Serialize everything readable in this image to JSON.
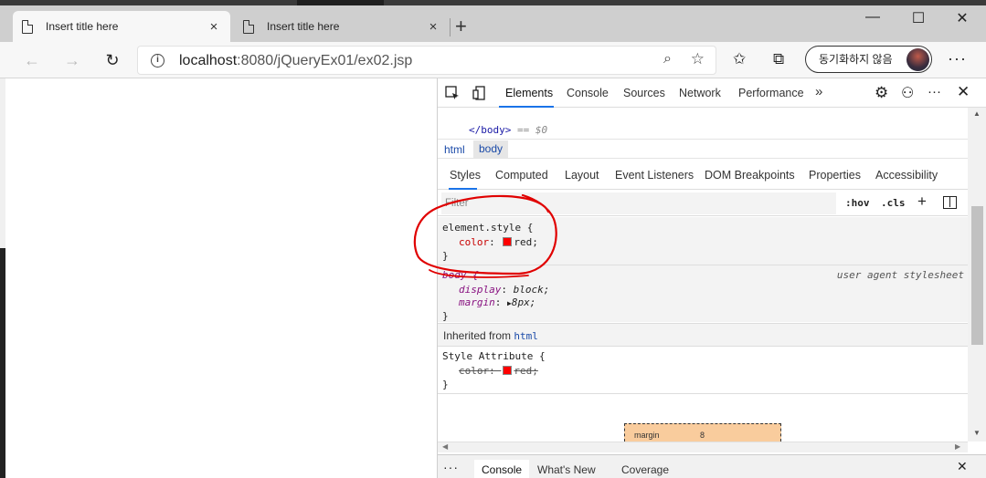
{
  "tabs": [
    {
      "title": "Insert title here",
      "active": true
    },
    {
      "title": "Insert title here",
      "active": false
    }
  ],
  "icons": {
    "close": "×",
    "newtab": "+",
    "minimize": "—",
    "maximize": "☐",
    "winclose": "✕",
    "back": "←",
    "forward": "→",
    "refresh": "↻",
    "info": "i",
    "zoom": "⌕",
    "star": "☆",
    "favorites": "✩",
    "collections": "⧉",
    "more": "···",
    "overflow": "»",
    "settings": "⚙",
    "feedback": "⚇",
    "plus": "+",
    "triangle": "▶",
    "scroll_up": "▲",
    "scroll_down": "▼",
    "scroll_left": "◀",
    "scroll_right": "▶"
  },
  "address": {
    "host": "localhost",
    "rest": ":8080/jQueryEx01/ex02.jsp"
  },
  "sync_button": "동기화하지 않음",
  "devtools": {
    "tabs": [
      "Elements",
      "Console",
      "Sources",
      "Network",
      "Performance"
    ],
    "dom_line": {
      "tag": "</body>",
      "eq": " == $0"
    },
    "breadcrumbs": [
      "html",
      "body"
    ],
    "subtabs": [
      "Styles",
      "Computed",
      "Layout",
      "Event Listeners",
      "DOM Breakpoints",
      "Properties",
      "Accessibility"
    ],
    "filter_placeholder": "Filter",
    "hov": ":hov",
    "cls": ".cls",
    "rules": {
      "element_selector": "element.style {",
      "element_prop": "color",
      "element_value": "red;",
      "close": "}",
      "body_selector": "body {",
      "ua_label": "user agent stylesheet",
      "body_prop1": "display",
      "body_val1": "block;",
      "body_prop2": "margin",
      "body_val2": "8px;",
      "inherited_text": "Inherited from ",
      "inherited_link": "html",
      "style_attr_selector": "Style Attribute {",
      "style_attr_prop": "color",
      "style_attr_value": "red;"
    },
    "boxmodel": {
      "label": "margin",
      "value": "8"
    },
    "drawer_tabs": [
      "Console",
      "What's New",
      "Coverage"
    ]
  },
  "colors": {
    "accent": "#1a73e8",
    "swatch": "#ff0000",
    "annotation": "#e00000"
  }
}
